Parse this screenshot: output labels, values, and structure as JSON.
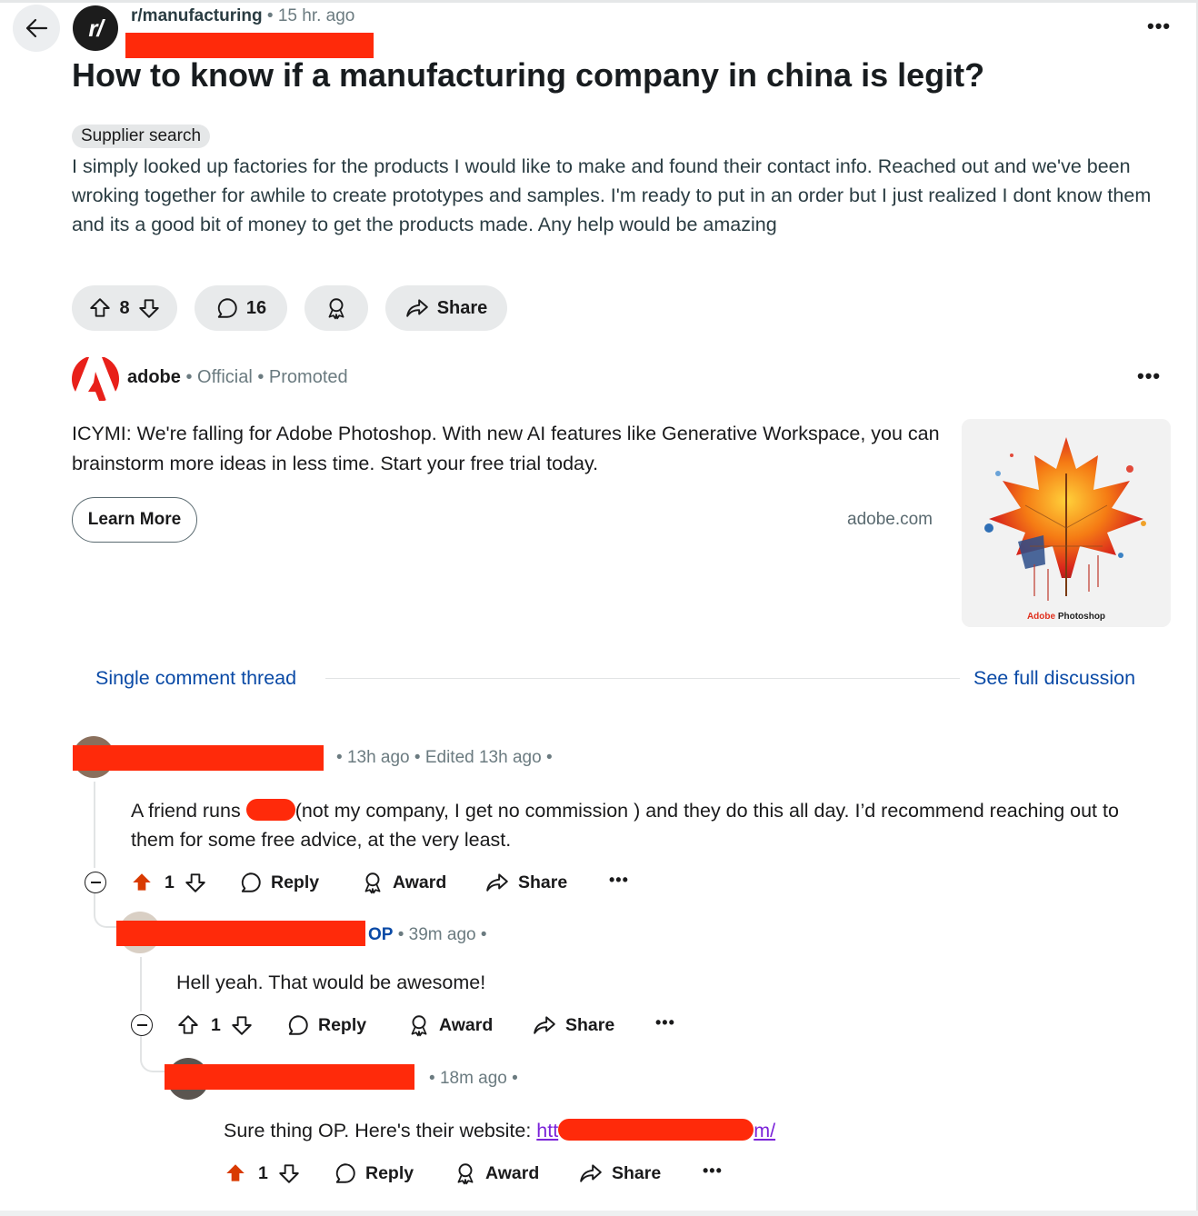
{
  "post": {
    "subreddit": "r/manufacturing",
    "time": "15 hr. ago",
    "title": "How to know if a manufacturing company in china is legit?",
    "flair": "Supplier search",
    "body": "I simply looked up factories for the products I would like to make and found their contact info. Reached out and we've been wroking together for awhile to create prototypes and samples. I'm ready to put in an order but I just realized I dont know them and its a good bit of money to get the products made. Any help would be amazing",
    "upvotes": "8",
    "comments": "16",
    "share_label": "Share"
  },
  "ad": {
    "brand": "adobe",
    "official": "Official",
    "promoted": "Promoted",
    "text": "ICYMI: We're falling for Adobe Photoshop. With new AI features like Generative Workspace, you can brainstorm more ideas in less time. Start your free trial today.",
    "cta": "Learn More",
    "domain": "adobe.com",
    "image_caption_brand": "Adobe",
    "image_caption_product": "Photoshop"
  },
  "thread": {
    "single_label": "Single comment thread",
    "full_label": "See full discussion"
  },
  "comments": [
    {
      "meta": "13h ago • Edited 13h ago •",
      "body_before": "A friend runs ",
      "body_after": "(not my company, I get no commission ) and they do this all day. I’d recommend reaching out to them for some free advice, at the very least.",
      "score": "1",
      "upvoted": true,
      "reply": "Reply",
      "award": "Award",
      "share": "Share"
    },
    {
      "op_badge": "OP",
      "meta": "39m ago •",
      "body": "Hell yeah. That would be awesome!",
      "score": "1",
      "upvoted": false,
      "reply": "Reply",
      "award": "Award",
      "share": "Share"
    },
    {
      "meta": "18m ago •",
      "body_before": "Sure thing OP. Here's their website: ",
      "link_start": "htt",
      "link_end": "m/",
      "score": "1",
      "upvoted": true,
      "reply": "Reply",
      "award": "Award",
      "share": "Share"
    }
  ],
  "colors": {
    "accent": "#0a4aa6",
    "upvote": "#d93a00",
    "redaction": "#ff2a0a",
    "link_visited": "#7b23d9"
  },
  "icons": [
    "back-arrow-icon",
    "more-icon",
    "upvote-icon",
    "downvote-icon",
    "comment-icon",
    "award-icon",
    "share-icon",
    "collapse-icon"
  ]
}
